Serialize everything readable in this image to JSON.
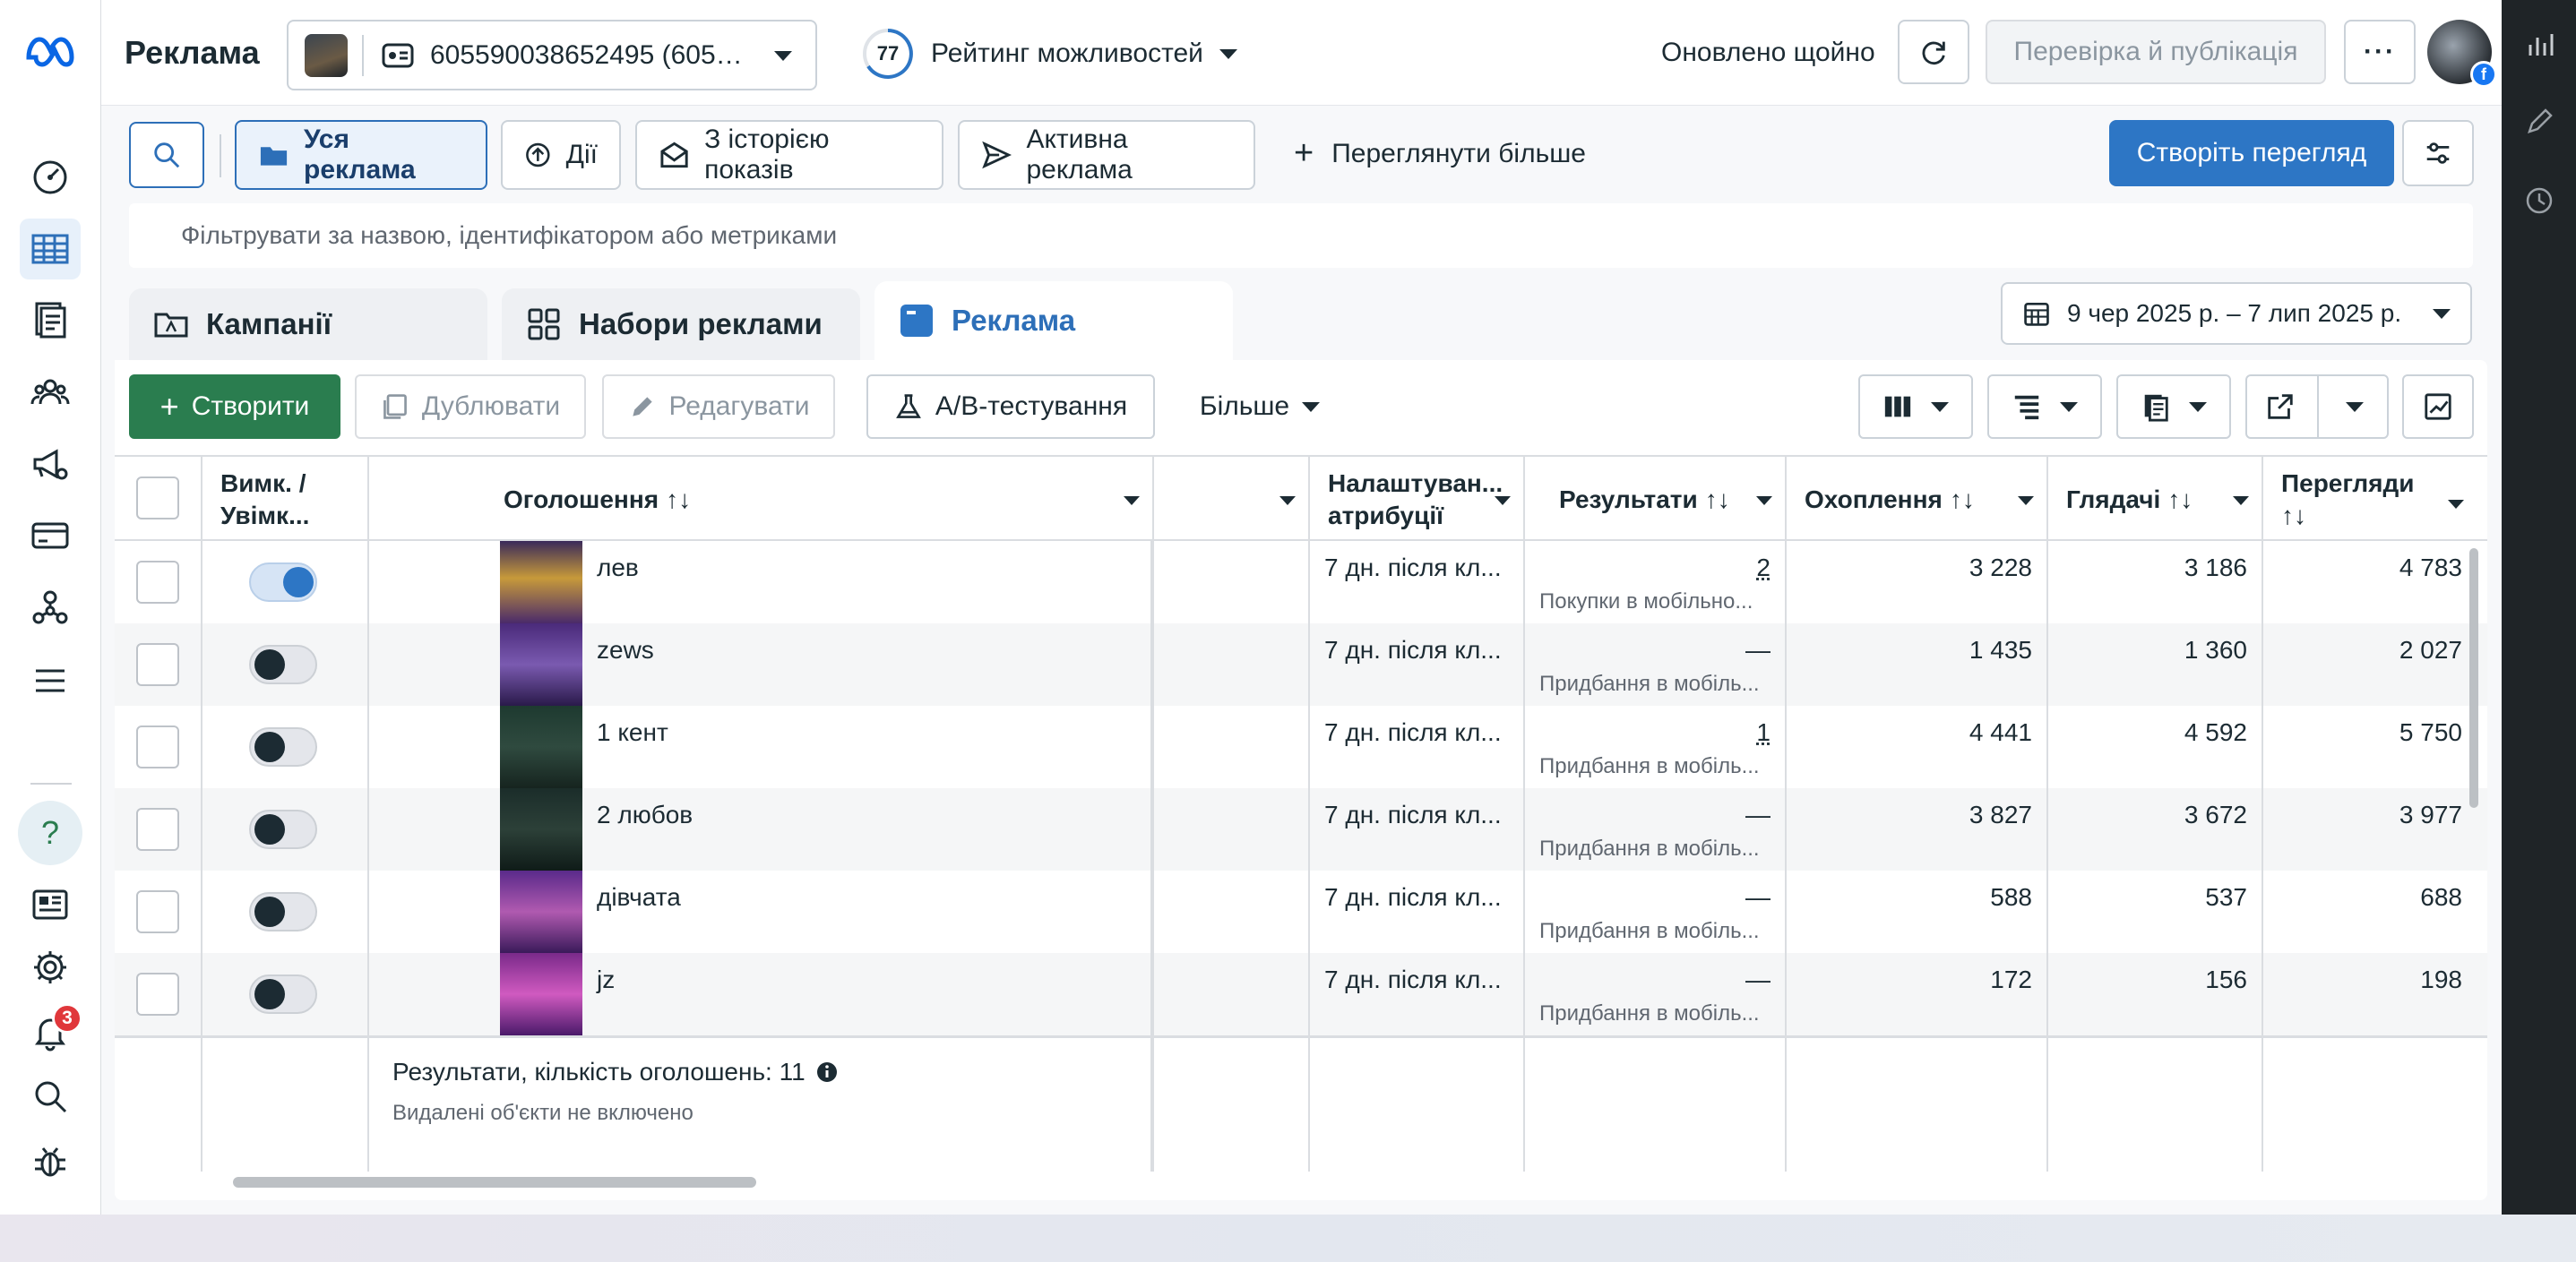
{
  "app": {
    "title": "Реклама"
  },
  "account": {
    "label": "605590038652495 (605…"
  },
  "opportunity": {
    "score": "77",
    "label": "Рейтинг можливостей"
  },
  "status": {
    "updated": "Оновлено щойно"
  },
  "topbar": {
    "review_label": "Перевірка й публікація",
    "more_label": "···"
  },
  "notifications": {
    "count": "3"
  },
  "filters": {
    "all_ads": "Уся реклама",
    "actions": "Дії",
    "with_history": "З історією показів",
    "active_ads": "Активна реклама",
    "see_more": "Переглянути більше",
    "create_view": "Створіть перегляд",
    "search_placeholder": "Фільтрувати за назвою, ідентифікатором або метриками"
  },
  "level_tabs": {
    "campaigns": "Кампанії",
    "ad_sets": "Набори реклами",
    "ads": "Реклама"
  },
  "date_range": "9 чер 2025 р. – 7 лип 2025 р.",
  "toolbar": {
    "create": "Створити",
    "duplicate": "Дублювати",
    "edit": "Редагувати",
    "ab_test": "A/B-тестування",
    "more": "Більше"
  },
  "table": {
    "headers": {
      "toggle": "Вимк. / Увімк...",
      "ad": "Оголошення",
      "attribution": "Налаштуван... атрибуції",
      "results": "Результати",
      "reach": "Охоплення",
      "viewers": "Глядачі",
      "views": "Перегляди"
    },
    "rows": [
      {
        "name": "лев",
        "on": true,
        "attribution": "7 дн. після кл...",
        "result": "2",
        "result_type": "Покупки в мобільно...",
        "reach": "3 228",
        "viewers": "3 186",
        "views": "4 783"
      },
      {
        "name": "zews",
        "on": false,
        "attribution": "7 дн. після кл...",
        "result": "—",
        "result_type": "Придбання в мобіль...",
        "reach": "1 435",
        "viewers": "1 360",
        "views": "2 027"
      },
      {
        "name": "1 кент",
        "on": false,
        "attribution": "7 дн. після кл...",
        "result": "1",
        "result_type": "Придбання в мобіль...",
        "reach": "4 441",
        "viewers": "4 592",
        "views": "5 750"
      },
      {
        "name": "2 любов",
        "on": false,
        "attribution": "7 дн. після кл...",
        "result": "—",
        "result_type": "Придбання в мобіль...",
        "reach": "3 827",
        "viewers": "3 672",
        "views": "3 977"
      },
      {
        "name": "дівчата",
        "on": false,
        "attribution": "7 дн. після кл...",
        "result": "—",
        "result_type": "Придбання в мобіль...",
        "reach": "588",
        "viewers": "537",
        "views": "688"
      },
      {
        "name": "jz",
        "on": false,
        "attribution": "7 дн. після кл...",
        "result": "—",
        "result_type": "Придбання в мобіль...",
        "reach": "172",
        "viewers": "156",
        "views": "198"
      }
    ],
    "summary": "Результати, кількість оголошень: 11",
    "summary_note": "Видалені об'єкти не включено"
  },
  "colors": {
    "primary_blue": "#2d76c5",
    "create_green": "#2a7d4f",
    "toggle_on": "#2d76c5",
    "badge_red": "#e0373b"
  }
}
